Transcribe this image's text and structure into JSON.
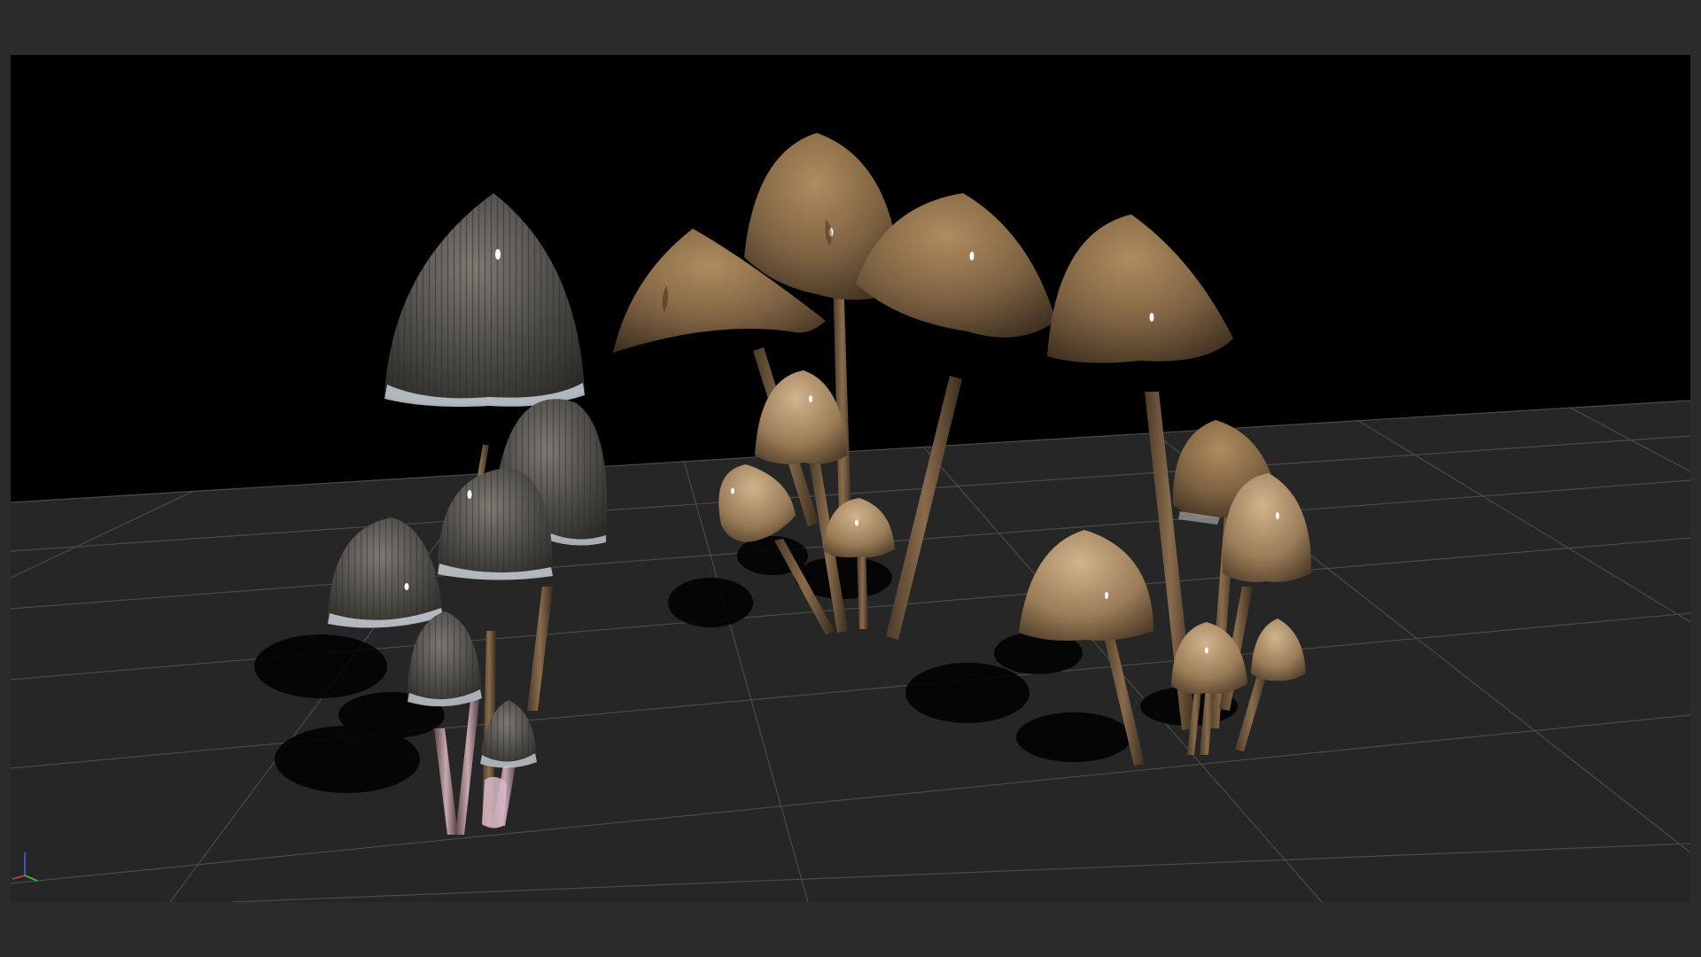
{
  "viewport": {
    "background_color": "#000000",
    "ground_color": "#262626",
    "grid_color": "#4a4a4a",
    "frame_color": "#2b2b2b"
  },
  "scene": {
    "groups": [
      {
        "name": "ink-cap-cluster",
        "cap_color": "#5c5a55",
        "cap_fringe_color": "#b8c0c8",
        "stem_color": "#6a5a48"
      },
      {
        "name": "brown-conical-cluster-center",
        "cap_color": "#8a6c4a",
        "stem_color": "#7a5c3c"
      },
      {
        "name": "brown-conical-cluster-right",
        "cap_color": "#7d6242",
        "stem_color": "#7a5c3c"
      }
    ]
  },
  "axis_gizmo": {
    "x_color": "#d04040",
    "y_color": "#40c040",
    "z_color": "#4060e0",
    "icon": "axis-gizmo-icon"
  }
}
